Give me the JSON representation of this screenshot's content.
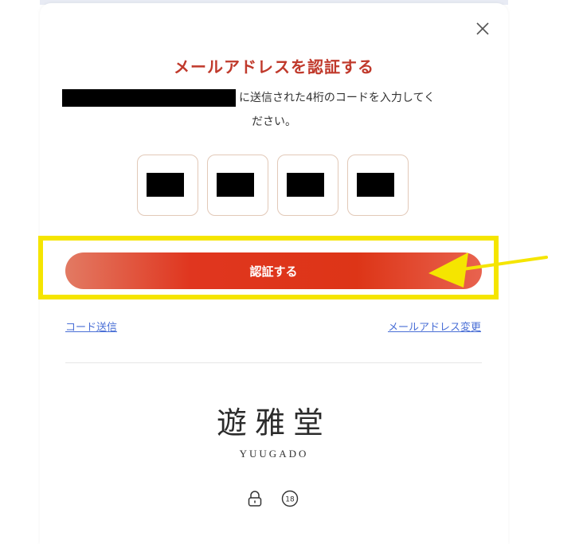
{
  "modal": {
    "title": "メールアドレスを認証する",
    "instruction_line1": "に送信された4桁のコードを入力してく",
    "instruction_line2": "ださい。",
    "verify_label": "認証する",
    "resend_label": "コード送信",
    "change_email_label": "メールアドレス変更"
  },
  "code": {
    "digits": [
      "",
      "",
      "",
      ""
    ]
  },
  "footer": {
    "logo_text": "遊雅堂",
    "logo_subtext": "YUUGADO",
    "icons": [
      "lock-icon",
      "age-18-icon"
    ]
  },
  "annotation": {
    "highlight_color": "#f5e500",
    "arrow_color": "#f5e500"
  },
  "colors": {
    "title": "#c0392b",
    "button_gradient": [
      "#e27a63",
      "#e0361f",
      "#e8634f"
    ],
    "link": "#4a6fd6"
  }
}
